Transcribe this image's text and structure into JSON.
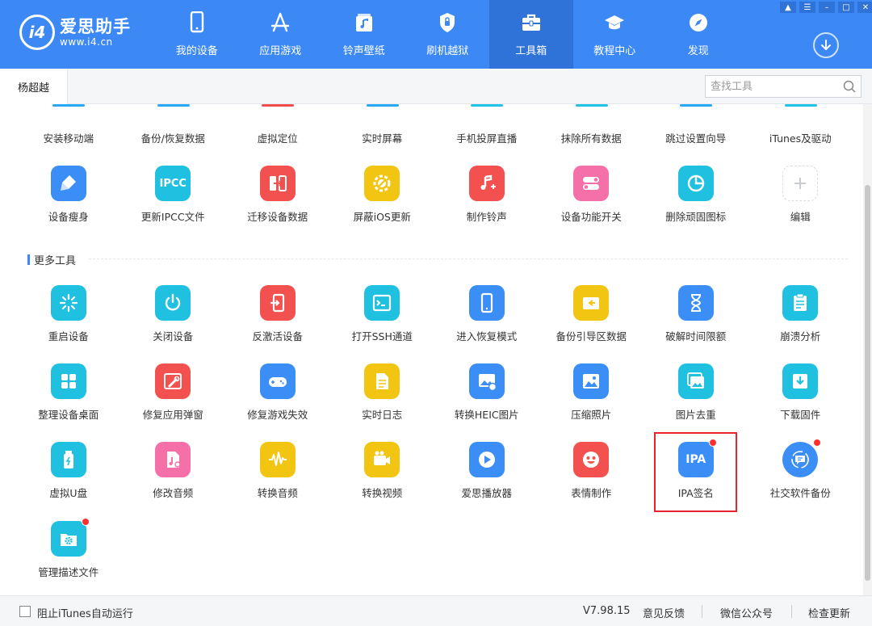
{
  "app": {
    "name": "爱思助手",
    "url": "www.i4.cn",
    "logo_mark": "i4"
  },
  "nav": [
    {
      "label": "我的设备",
      "icon": "phone-icon"
    },
    {
      "label": "应用游戏",
      "icon": "app-store-icon"
    },
    {
      "label": "铃声壁纸",
      "icon": "music-image-icon"
    },
    {
      "label": "刷机越狱",
      "icon": "shield-icon"
    },
    {
      "label": "工具箱",
      "icon": "toolbox-icon",
      "active": true
    },
    {
      "label": "教程中心",
      "icon": "graduation-cap-icon"
    },
    {
      "label": "发现",
      "icon": "compass-icon"
    }
  ],
  "tabbar": {
    "active_tab": "杨超越",
    "search_placeholder": "查找工具"
  },
  "partial_row": [
    {
      "label": "安装移动端",
      "color": "#2aa7f5"
    },
    {
      "label": "备份/恢复数据",
      "color": "#2aa7f5"
    },
    {
      "label": "虚拟定位",
      "color": "#f24d4d"
    },
    {
      "label": "实时屏幕",
      "color": "#2aa7f5"
    },
    {
      "label": "手机投屏直播",
      "color": "#22c3e8"
    },
    {
      "label": "抹除所有数据",
      "color": "#22c3e8"
    },
    {
      "label": "跳过设置向导",
      "color": "#2aa7f5"
    },
    {
      "label": "iTunes及驱动",
      "color": "#22c3e8"
    }
  ],
  "top_tools": [
    {
      "label": "设备瘦身",
      "icon": "broom-icon",
      "color": "#3a8ef5"
    },
    {
      "label": "更新IPCC文件",
      "icon": "ipcc-icon",
      "text": "IPCC",
      "color": "#1fc0e0"
    },
    {
      "label": "迁移设备数据",
      "icon": "transfer-icon",
      "color": "#f2514f"
    },
    {
      "label": "屏蔽iOS更新",
      "icon": "gear-block-icon",
      "color": "#f2c512"
    },
    {
      "label": "制作铃声",
      "icon": "music-note-icon",
      "color": "#f2514f"
    },
    {
      "label": "设备功能开关",
      "icon": "toggle-icon",
      "color": "#f56fa8"
    },
    {
      "label": "删除顽固图标",
      "icon": "pie-icon",
      "color": "#1fc0e0"
    },
    {
      "label": "编辑",
      "icon": "plus-icon",
      "color": "#ffffff"
    }
  ],
  "section": {
    "title": "更多工具"
  },
  "more_tools": [
    [
      {
        "label": "重启设备",
        "icon": "sparkle-icon",
        "color": "#1fc0e0"
      },
      {
        "label": "关闭设备",
        "icon": "power-icon",
        "color": "#1fc0e0"
      },
      {
        "label": "反激活设备",
        "icon": "deactivate-icon",
        "color": "#f2514f"
      },
      {
        "label": "打开SSH通道",
        "icon": "terminal-icon",
        "color": "#1fc0e0"
      },
      {
        "label": "进入恢复模式",
        "icon": "phone-recovery-icon",
        "color": "#3a8ef5"
      },
      {
        "label": "备份引导区数据",
        "icon": "disk-backup-icon",
        "color": "#f2c512"
      },
      {
        "label": "破解时间限额",
        "icon": "hourglass-icon",
        "color": "#3a8ef5"
      },
      {
        "label": "崩溃分析",
        "icon": "clipboard-icon",
        "color": "#1fc0e0"
      }
    ],
    [
      {
        "label": "整理设备桌面",
        "icon": "grid-icon",
        "color": "#1fc0e0"
      },
      {
        "label": "修复应用弹窗",
        "icon": "wrench-window-icon",
        "color": "#f2514f"
      },
      {
        "label": "修复游戏失效",
        "icon": "gamepad-icon",
        "color": "#3a8ef5"
      },
      {
        "label": "实时日志",
        "icon": "document-icon",
        "color": "#f2c512"
      },
      {
        "label": "转换HEIC图片",
        "icon": "image-convert-icon",
        "color": "#3a8ef5"
      },
      {
        "label": "压缩照片",
        "icon": "image-icon",
        "color": "#3a8ef5"
      },
      {
        "label": "图片去重",
        "icon": "images-icon",
        "color": "#1fc0e0"
      },
      {
        "label": "下载固件",
        "icon": "download-box-icon",
        "color": "#1fc0e0"
      }
    ],
    [
      {
        "label": "虚拟U盘",
        "icon": "usb-drive-icon",
        "color": "#1fc0e0"
      },
      {
        "label": "修改音频",
        "icon": "audio-file-icon",
        "color": "#f56fa8"
      },
      {
        "label": "转换音频",
        "icon": "waveform-icon",
        "color": "#f2c512"
      },
      {
        "label": "转换视频",
        "icon": "video-camera-icon",
        "color": "#f2c512"
      },
      {
        "label": "爱思播放器",
        "icon": "play-icon",
        "color": "#3a8ef5"
      },
      {
        "label": "表情制作",
        "icon": "smiley-icon",
        "color": "#f2514f"
      },
      {
        "label": "IPA签名",
        "icon": "ipa-icon",
        "text": "IPA",
        "color": "#3a8ef5",
        "badge": true
      },
      {
        "label": "社交软件备份",
        "icon": "chat-backup-icon",
        "color": "#3a8ef5",
        "badge": true
      }
    ],
    [
      {
        "label": "管理描述文件",
        "icon": "folder-gear-icon",
        "color": "#1fc0e0",
        "badge": true
      }
    ]
  ],
  "footer": {
    "checkbox_label": "阻止iTunes自动运行",
    "version": "V7.98.15",
    "feedback": "意见反馈",
    "wechat": "微信公众号",
    "check_update": "检查更新"
  }
}
